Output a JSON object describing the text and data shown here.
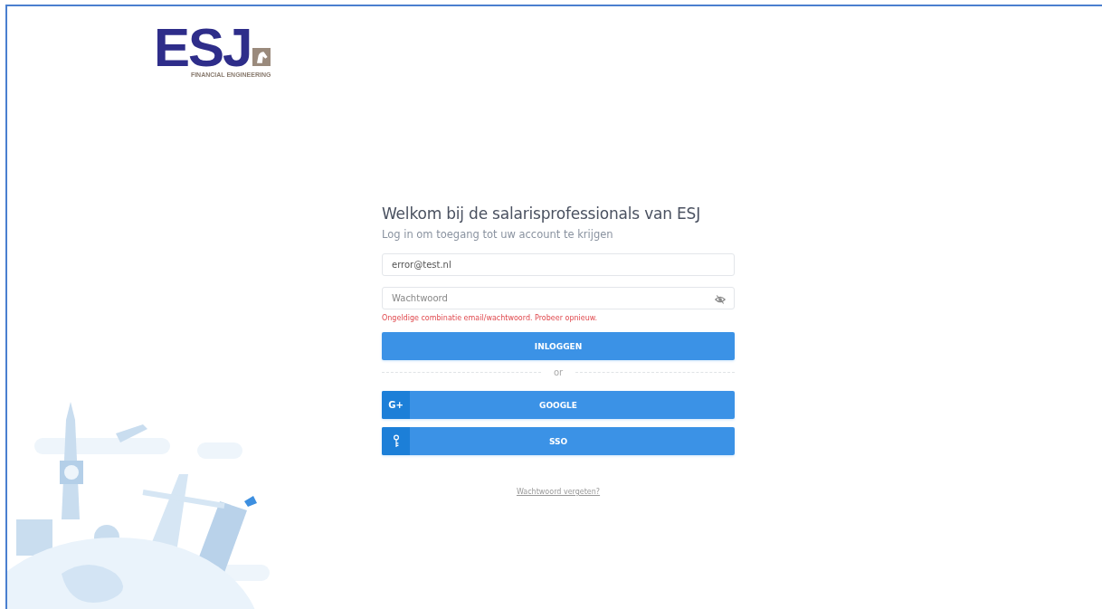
{
  "logo": {
    "wordmark": "ESJ",
    "tagline": "FINANCIAL ENGINEERING"
  },
  "login": {
    "title": "Welkom bij de salarisprofessionals van ESJ",
    "subtitle": "Log in om toegang tot uw account te krijgen",
    "email": {
      "value": "error@test.nl"
    },
    "password": {
      "placeholder": "Wachtwoord"
    },
    "error": "Ongeldige combinatie email/wachtwoord. Probeer opnieuw.",
    "submit": "INLOGGEN",
    "divider": "or",
    "providers": [
      {
        "kind": "google",
        "icon_text": "G+",
        "label": "GOOGLE"
      },
      {
        "kind": "sso",
        "label": "SSO"
      }
    ],
    "forgot_link": "Wachtwoord vergeten?"
  }
}
